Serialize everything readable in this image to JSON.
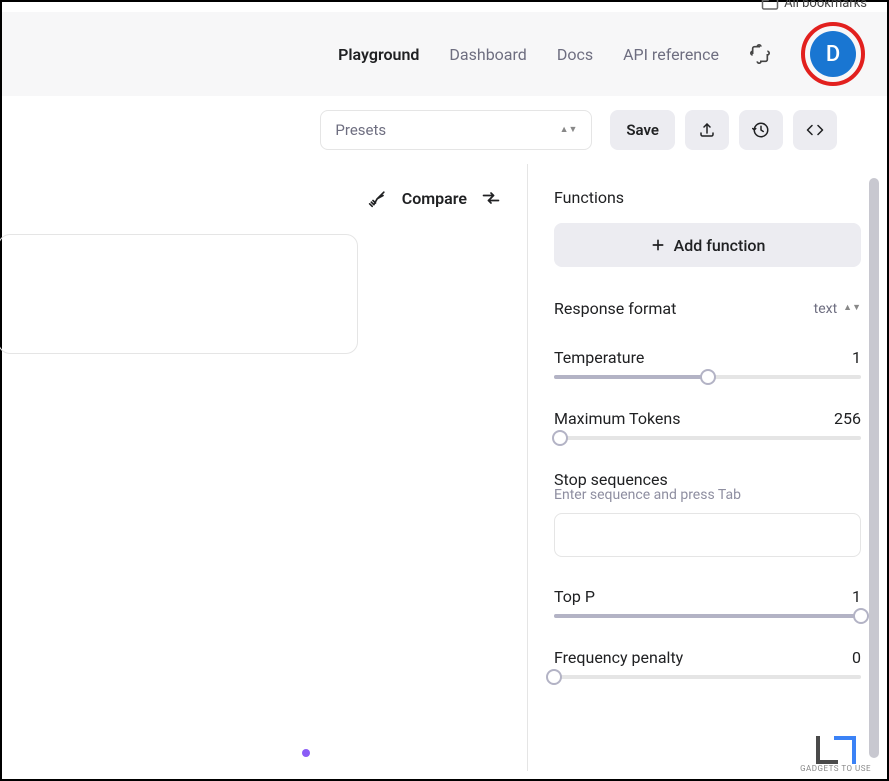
{
  "topbar": {
    "bookmarks": "All bookmarks"
  },
  "nav": {
    "playground": "Playground",
    "dashboard": "Dashboard",
    "docs": "Docs",
    "api_reference": "API reference"
  },
  "avatar": {
    "initial": "D"
  },
  "toolbar": {
    "presets_placeholder": "Presets",
    "save_label": "Save"
  },
  "compare": {
    "label": "Compare"
  },
  "sidebar": {
    "functions_title": "Functions",
    "add_function_label": "Add function",
    "response_format_label": "Response format",
    "response_format_value": "text",
    "temperature_label": "Temperature",
    "temperature_value": "1",
    "max_tokens_label": "Maximum Tokens",
    "max_tokens_value": "256",
    "stop_sequences_label": "Stop sequences",
    "stop_sequences_hint": "Enter sequence and press Tab",
    "top_p_label": "Top P",
    "top_p_value": "1",
    "frequency_penalty_label": "Frequency penalty",
    "frequency_penalty_value": "0"
  },
  "watermark": "GADGETS TO USE"
}
